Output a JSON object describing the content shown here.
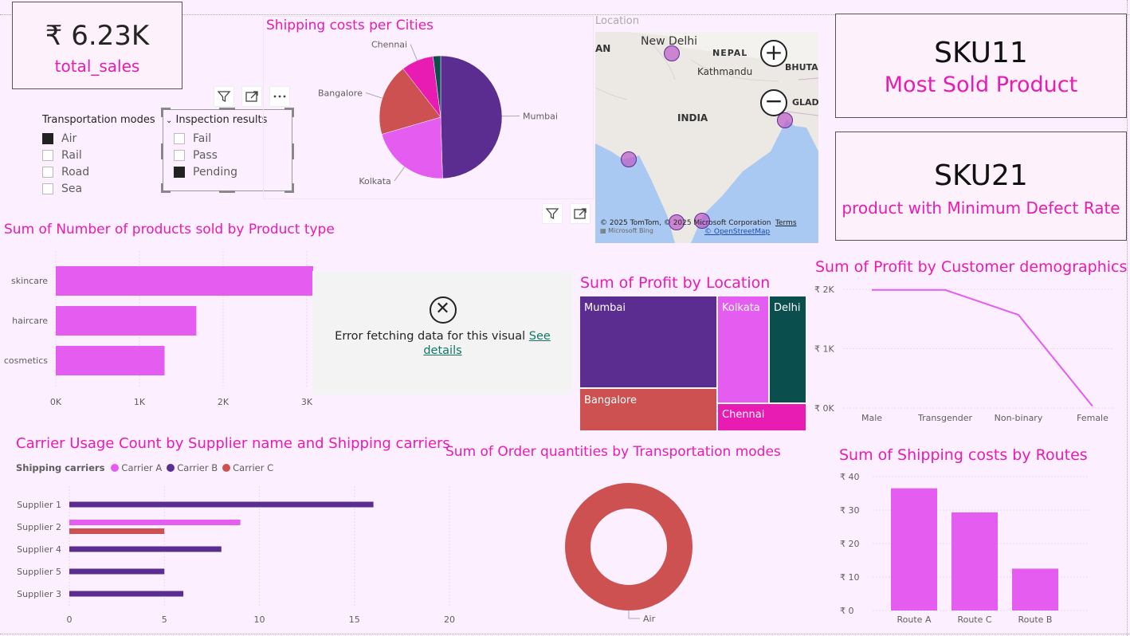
{
  "kpi_sales": {
    "value": "₹ 6.23K",
    "label": "total_sales"
  },
  "kpi_sku_sold": {
    "value": "SKU11",
    "label": "Most Sold Product"
  },
  "kpi_sku_defect": {
    "value": "SKU21",
    "label": "product with Minimum Defect Rate"
  },
  "slicer_transport": {
    "title": "Transportation modes",
    "items": [
      {
        "label": "Air",
        "checked": true
      },
      {
        "label": "Rail",
        "checked": false
      },
      {
        "label": "Road",
        "checked": false
      },
      {
        "label": "Sea",
        "checked": false
      }
    ]
  },
  "slicer_inspection": {
    "title": "Inspection results",
    "items": [
      {
        "label": "Fail",
        "checked": false
      },
      {
        "label": "Pass",
        "checked": false
      },
      {
        "label": "Pending",
        "checked": true
      }
    ]
  },
  "map": {
    "title": "Location",
    "labels": {
      "delhi": "New Delhi",
      "nepal": "NEPAL",
      "kathmandu": "Kathmandu",
      "india": "INDIA",
      "bhutan": "BHUTA",
      "bangla": "GLAD",
      "pakistan": "AN"
    },
    "attribution": "© 2025 TomTom, © 2025 Microsoft Corporation",
    "terms": "Terms",
    "osm": "© OpenStreetMap",
    "bing": "Microsoft Bing"
  },
  "error_visual": {
    "message": "Error fetching data for this visual",
    "link1": "See",
    "link2": "details"
  },
  "colors": {
    "purple": "#5b2d90",
    "magenta": "#e55cf0",
    "red": "#cd5151",
    "pink": "#e81cb2",
    "teal": "#0b4e4e"
  },
  "chart_data": [
    {
      "id": "shipping_costs_cities",
      "type": "pie",
      "title": "Shipping costs per Cities",
      "categories": [
        "Mumbai",
        "Kolkata",
        "Bangalore",
        "Chennai",
        "Delhi"
      ],
      "values": [
        49.5,
        21,
        19,
        8.5,
        2
      ],
      "colors": [
        "#5b2d90",
        "#e55cf0",
        "#cd5151",
        "#e81cb2",
        "#0b4e4e"
      ],
      "shown_labels": [
        "Mumbai",
        "Kolkata",
        "Bangalore",
        "Chennai"
      ]
    },
    {
      "id": "products_sold_type",
      "type": "bar",
      "title": "Sum of Number of products sold by Product type",
      "categories": [
        "skincare",
        "haircare",
        "cosmetics"
      ],
      "values": [
        3100,
        1680,
        1300
      ],
      "xticks": [
        "0K",
        "1K",
        "2K",
        "3K"
      ],
      "xlim": [
        0,
        3000
      ]
    },
    {
      "id": "profit_location",
      "type": "heatmap",
      "title": "Sum of Profit by Location",
      "categories": [
        "Mumbai",
        "Bangalore",
        "Kolkata",
        "Chennai",
        "Delhi"
      ],
      "colors": [
        "#5b2d90",
        "#cd5151",
        "#e55cf0",
        "#e81cb2",
        "#0b4e4e"
      ]
    },
    {
      "id": "profit_demographics",
      "type": "line",
      "title": "Sum of Profit by Customer demographics",
      "categories": [
        "Male",
        "Transgender",
        "Non-binary",
        "Female"
      ],
      "values": [
        1990,
        1990,
        1570,
        30
      ],
      "yticks": [
        "₹ 0K",
        "₹ 1K",
        "₹ 2K"
      ],
      "ylim": [
        0,
        2000
      ]
    },
    {
      "id": "carrier_usage",
      "type": "bar",
      "title": "Carrier Usage Count by Supplier name and Shipping carriers",
      "legend_title": "Shipping carriers",
      "categories": [
        "Supplier 1",
        "Supplier 2",
        "Supplier 4",
        "Supplier 5",
        "Supplier 3"
      ],
      "series": [
        {
          "name": "Carrier A",
          "color": "#e55cf0",
          "values": [
            0,
            9,
            0,
            0,
            0
          ]
        },
        {
          "name": "Carrier B",
          "color": "#5b2d90",
          "values": [
            16,
            0,
            8,
            5,
            6
          ]
        },
        {
          "name": "Carrier C",
          "color": "#cd5151",
          "values": [
            0,
            5,
            0,
            0,
            0
          ]
        }
      ],
      "xticks": [
        "0",
        "5",
        "10",
        "15",
        "20"
      ],
      "xlim": [
        0,
        20
      ]
    },
    {
      "id": "order_qty_transport",
      "type": "pie",
      "title": "Sum of Order quantities by Transportation modes",
      "categories": [
        "Air"
      ],
      "values": [
        100
      ],
      "colors": [
        "#cd5151"
      ]
    },
    {
      "id": "shipping_routes",
      "type": "bar",
      "title": "Sum of Shipping costs by Routes",
      "categories": [
        "Route A",
        "Route C",
        "Route B"
      ],
      "values": [
        36.5,
        29.3,
        12.5
      ],
      "yticks": [
        "₹ 0",
        "₹ 10",
        "₹ 20",
        "₹ 30",
        "₹ 40"
      ],
      "ylim": [
        0,
        40
      ]
    }
  ]
}
